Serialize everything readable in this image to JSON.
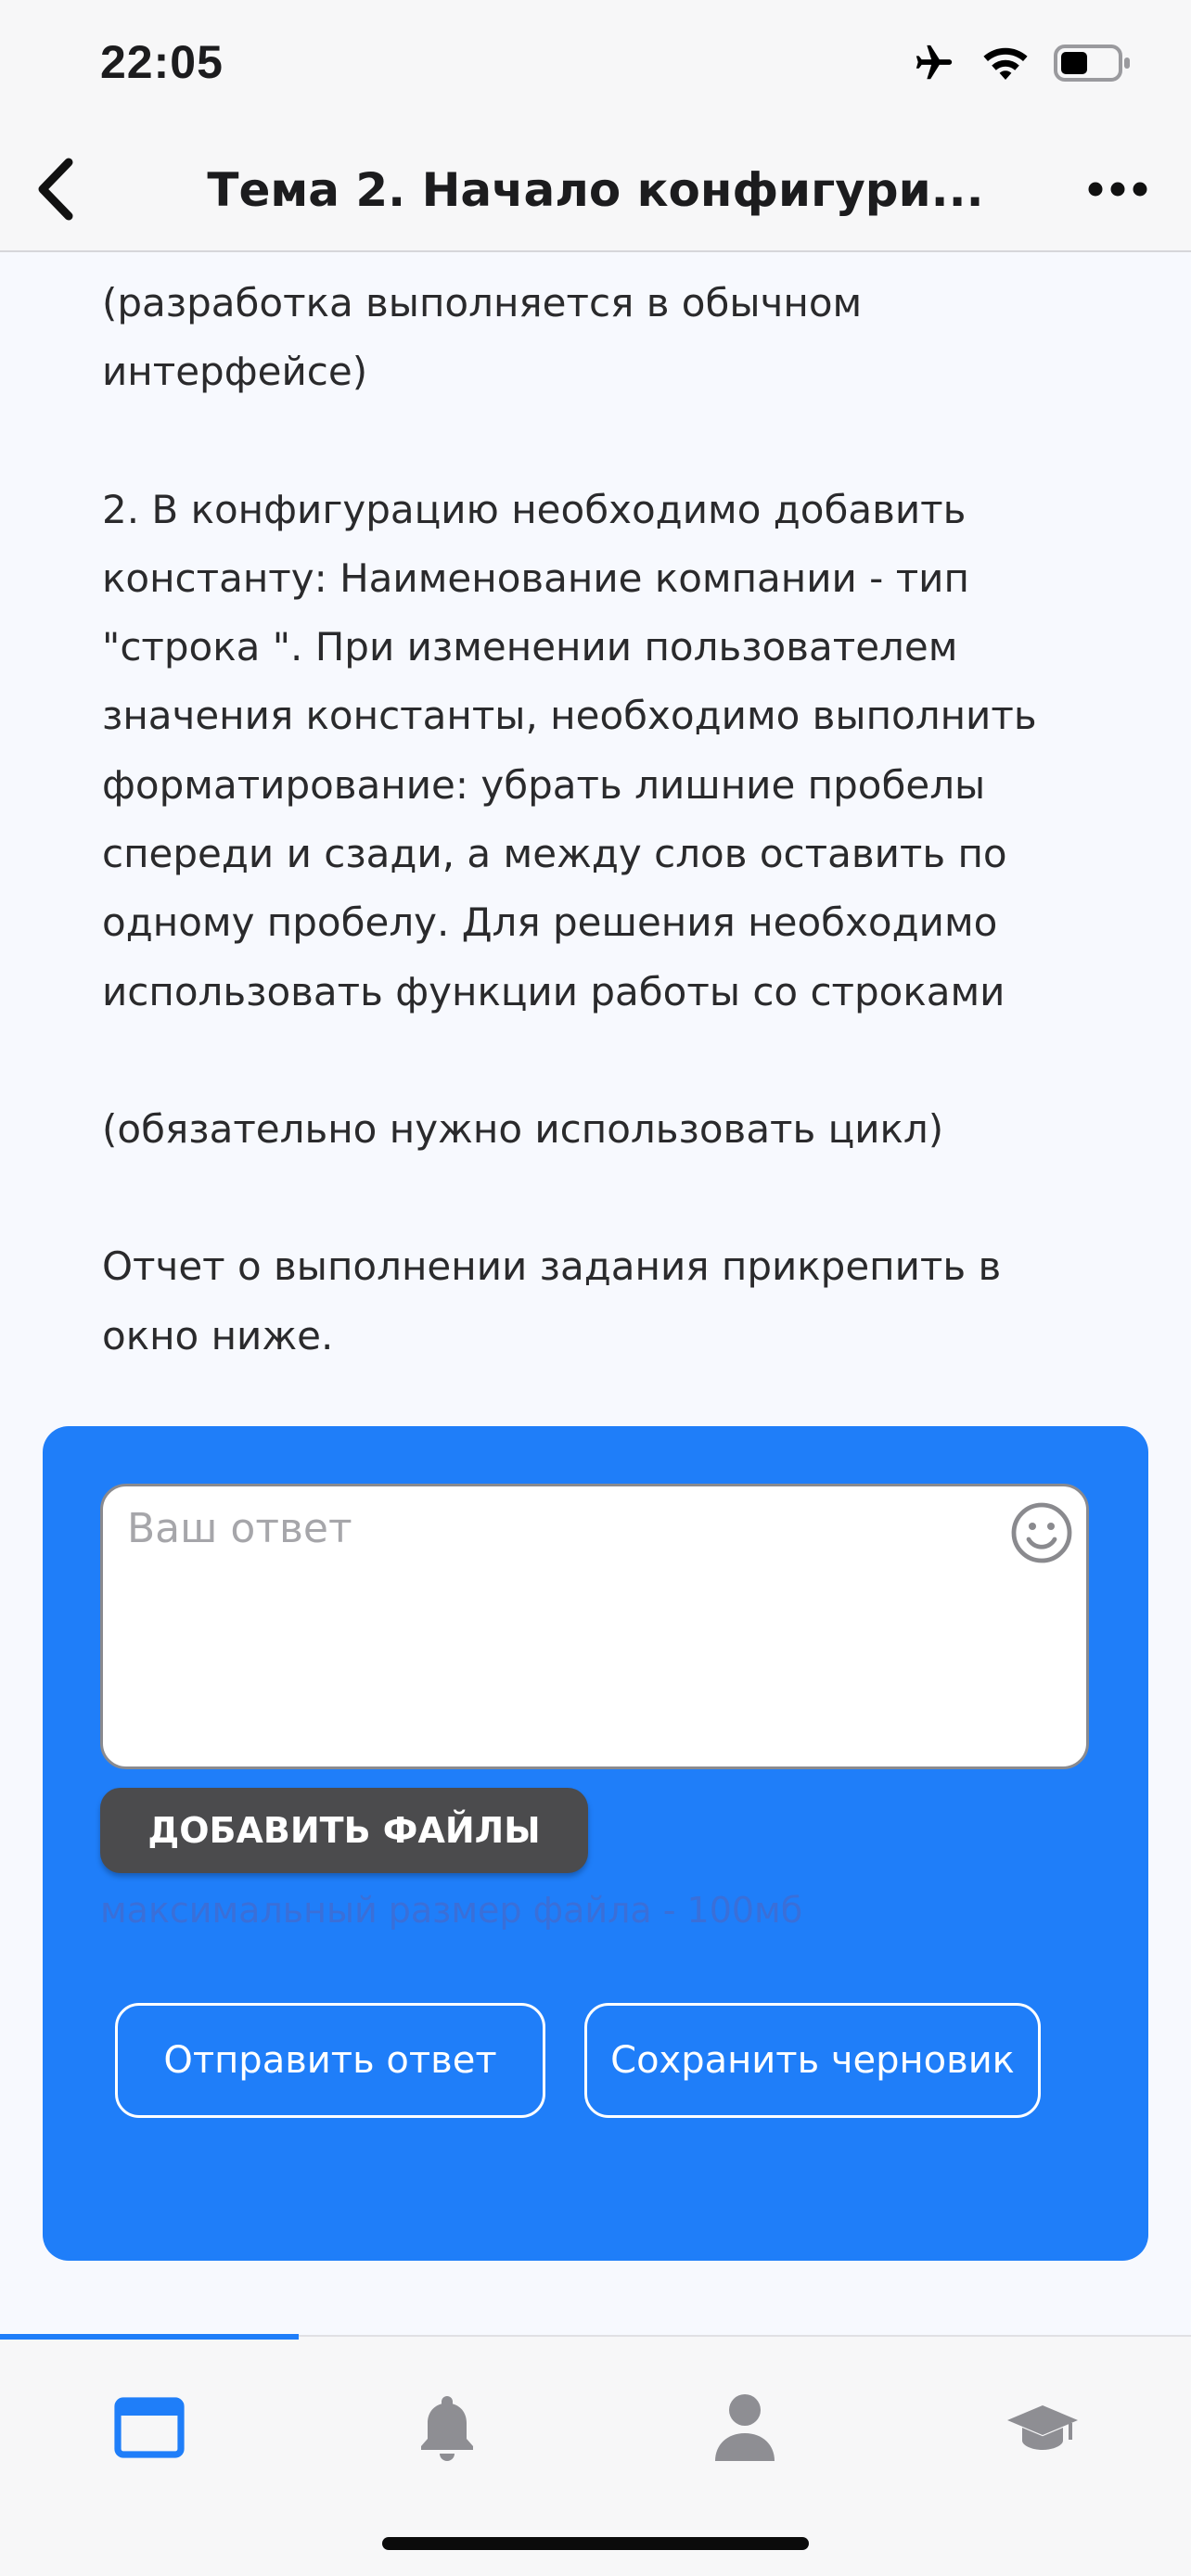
{
  "status_bar": {
    "time": "22:05",
    "icons": [
      "airplane-icon",
      "wifi-icon",
      "battery-icon"
    ]
  },
  "nav": {
    "title": "Тема 2. Начало конфигури...",
    "back_icon": "chevron-left-icon",
    "more_icon": "more-icon"
  },
  "content": {
    "paragraphs": [
      "(разработка выполняется в обычном\nинтерфейсе)",
      "2. В конфигурацию необходимо добавить\nконстанту: Наименование компании - тип\n\"строка \". При изменении пользователем\nзначения константы, необходимо выполнить\nформатирование: убрать лишние пробелы\nспереди и сзади, а между слов оставить по\nодному пробелу. Для решения необходимо\nиспользовать функции работы со строками",
      "(обязательно нужно использовать цикл)",
      "Отчет о выполнении задания прикрепить в\nокно ниже."
    ]
  },
  "answer": {
    "placeholder": "Ваш ответ",
    "emoji_icon": "emoji-icon",
    "add_files_label": "ДОБАВИТЬ ФАЙЛЫ",
    "file_hint": "максимальный размер файла - 100мб",
    "send_label": "Отправить ответ",
    "draft_label": "Сохранить черновик"
  },
  "tab_bar": {
    "tabs": [
      {
        "icon": "window-icon",
        "active": true
      },
      {
        "icon": "bell-icon",
        "active": false
      },
      {
        "icon": "person-icon",
        "active": false
      },
      {
        "icon": "graduation-cap-icon",
        "active": false
      }
    ]
  },
  "colors": {
    "accent": "#1f7ef9",
    "panel": "#1f7ef9",
    "inactive_icon": "#8e8e93",
    "add_files_button": "#4b4b4d"
  }
}
